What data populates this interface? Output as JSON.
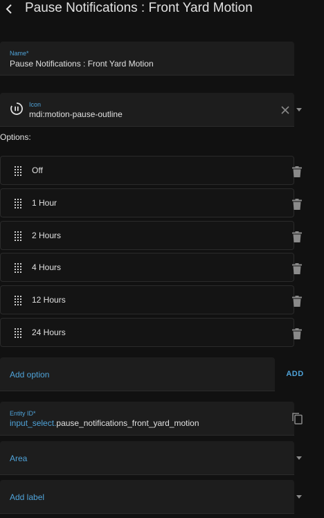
{
  "header": {
    "title": "Pause Notifications : Front Yard Motion",
    "back_icon": "chevron-left-icon"
  },
  "name_field": {
    "label": "Name*",
    "value": "Pause Notifications : Front Yard Motion"
  },
  "icon_field": {
    "label": "Icon",
    "value": "mdi:motion-pause-outline",
    "icon": "motion-pause-outline-icon"
  },
  "options": {
    "heading": "Options:",
    "items": [
      {
        "label": "Off"
      },
      {
        "label": "1 Hour"
      },
      {
        "label": "2 Hours"
      },
      {
        "label": "4 Hours"
      },
      {
        "label": "12 Hours"
      },
      {
        "label": "24 Hours"
      }
    ]
  },
  "add_option": {
    "placeholder": "Add option",
    "button_label": "ADD"
  },
  "entity_field": {
    "label": "Entity ID*",
    "domain": "input_select.",
    "object_id": "pause_notifications_front_yard_motion"
  },
  "area_field": {
    "label": "Area"
  },
  "label_field": {
    "label": "Add label"
  },
  "colors": {
    "background": "#111111",
    "field_background": "#1d1d1d",
    "accent": "#4fa3d9",
    "text": "#e1e1e1",
    "icon": "#8a8a8a"
  }
}
